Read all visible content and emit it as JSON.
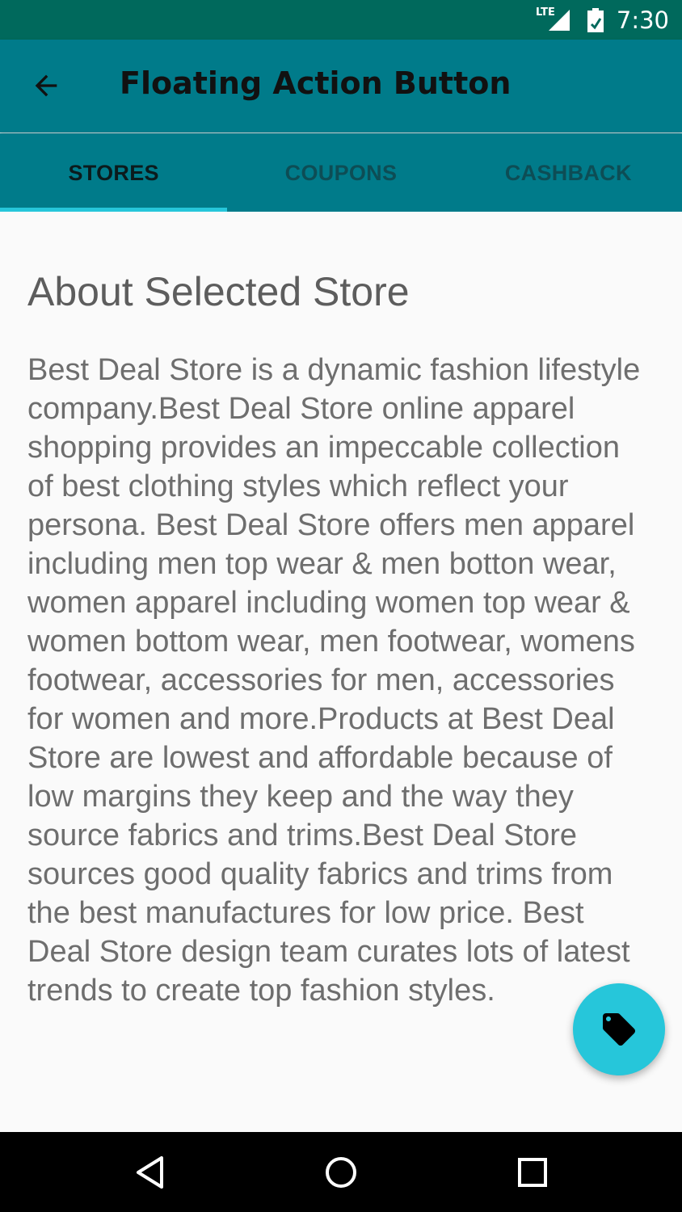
{
  "status_bar": {
    "network": "LTE",
    "time": "7:30"
  },
  "app_bar": {
    "title": "Floating Action Button"
  },
  "tabs": [
    {
      "label": "STORES",
      "active": true
    },
    {
      "label": "COUPONS",
      "active": false
    },
    {
      "label": "CASHBACK",
      "active": false
    }
  ],
  "content": {
    "heading": "About Selected Store",
    "body": "Best Deal Store is a dynamic fashion lifestyle company.Best Deal Store online apparel shopping provides an impeccable collection of best clothing styles which reflect your persona. Best Deal Store offers men apparel including men top wear & men botton wear, women apparel including women top wear & women bottom wear, men footwear, womens footwear, accessories for men, accessories for women and more.Products at Best Deal Store are lowest and affordable because of low margins they keep and the way they source fabrics and trims.Best Deal Store sources good quality fabrics and trims from the best manufactures for low price. Best Deal Store design team curates lots of latest trends to create top fashion styles."
  },
  "colors": {
    "status_bar": "#00695c",
    "primary": "#007b8a",
    "accent": "#26c6da"
  },
  "icons": {
    "back": "arrow-back-icon",
    "fab": "tag-icon",
    "nav": [
      "back-triangle-icon",
      "home-circle-icon",
      "recents-square-icon"
    ]
  }
}
